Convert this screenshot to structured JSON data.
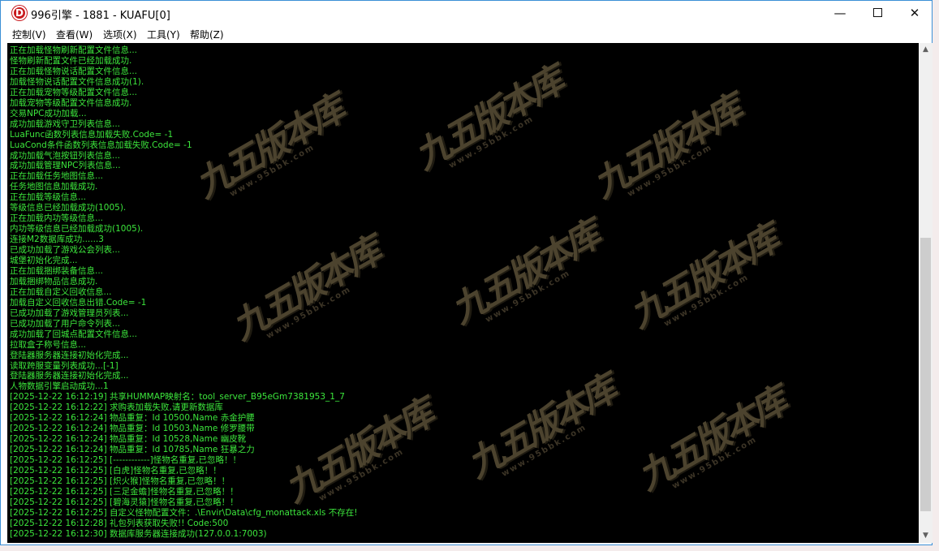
{
  "window": {
    "title": "996引擎 - 1881 - KUAFU[0]",
    "app_icon_letter": "D",
    "minimize_glyph": "—",
    "close_glyph": "✕"
  },
  "menu": [
    "控制(V)",
    "查看(W)",
    "选项(X)",
    "工具(Y)",
    "帮助(Z)"
  ],
  "watermark": {
    "text": "九五版本库",
    "subtext": "www.95bbk.com"
  },
  "log": [
    "正在加载怪物刷新配置文件信息...",
    "怪物刷新配置文件已经加载成功.",
    "正在加载怪物说话配置文件信息...",
    "加载怪物说话配置文件信息成功(1).",
    "正在加载宠物等级配置文件信息...",
    "加载宠物等级配置文件信息成功.",
    "交易NPC成功加载...",
    "成功加载游戏守卫列表信息...",
    "LuaFunc函数列表信息加载失败.Code= -1",
    "LuaCond条件函数列表信息加载失败.Code= -1",
    "成功加载气泡按钮列表信息...",
    "成功加载管理NPC列表信息...",
    "正在加载任务地图信息...",
    "任务地图信息加载成功.",
    "正在加载等级信息...",
    "等级信息已经加载成功(1005).",
    "正在加载内功等级信息...",
    "内功等级信息已经加载成功(1005).",
    "连接M2数据库成功......3",
    "已成功加载了游戏公会列表...",
    "城堡初始化完成...",
    "正在加载捆绑装备信息...",
    "加载捆绑物品信息成功.",
    "正在加载自定义回收信息...",
    "加载自定义回收信息出错.Code= -1",
    "已成功加载了游戏管理员列表...",
    "已成功加载了用户命令列表...",
    "成功加载了回城点配置文件信息...",
    "拉取盒子称号信息...",
    "登陆器服务器连接初始化完成...",
    "读取跨服变量列表成功...[-1]",
    "登陆器服务器连接初始化完成...",
    "人物数据引擎启动成功...1",
    "[2025-12-22 16:12:19] 共享HUMMAP映射名：tool_server_B95eGm7381953_1_7",
    "[2025-12-22 16:12:22] 求购表加载失败,请更新数据库",
    "[2025-12-22 16:12:24] 物品重复：Id 10500,Name 赤金护腰",
    "[2025-12-22 16:12:24] 物品重复：Id 10503,Name 修罗腰带",
    "[2025-12-22 16:12:24] 物品重复：Id 10528,Name 幽皮靴",
    "[2025-12-22 16:12:24] 物品重复：Id 10785,Name 狂暴之力",
    "[2025-12-22 16:12:25] [------------]怪物名重复,已忽略！！",
    "[2025-12-22 16:12:25] [白虎]怪物名重复,已忽略！！",
    "[2025-12-22 16:12:25] [炽火猴]怪物名重复,已忽略！！",
    "[2025-12-22 16:12:25] [三足金蟾]怪物名重复,已忽略！！",
    "[2025-12-22 16:12:25] [碧海灵猿]怪物名重复,已忽略！！",
    "[2025-12-22 16:12:25] 自定义怪物配置文件：.\\Envir\\Data\\cfg_monattack.xls 不存在!",
    "[2025-12-22 16:12:28] 礼包列表获取失败!! Code:500",
    "[2025-12-22 16:12:30] 数据库服务器连接成功(127.0.0.1:7003)"
  ],
  "colors": {
    "console_bg": "#000000",
    "console_text": "#3ce63c",
    "window_border": "#3b8fd6"
  }
}
